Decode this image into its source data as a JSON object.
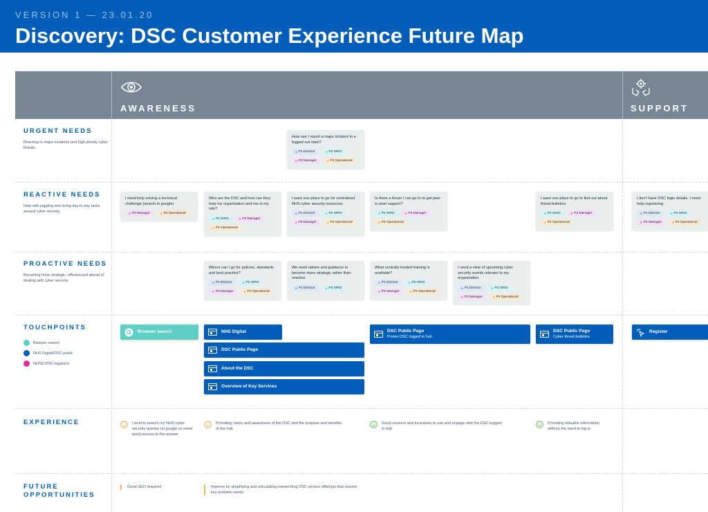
{
  "header": {
    "version": "VERSION 1 — 23.01.20",
    "title": "Discovery: DSC Customer Experience Future Map"
  },
  "phases": [
    {
      "label": "AWARENESS",
      "icon": "eye-icon"
    },
    {
      "label": "SUPPORT",
      "icon": "hands-gear-icon"
    }
  ],
  "rows": {
    "urgent": {
      "title": "URGENT NEEDS",
      "desc": "Reacting to major incidents and high priority cyber threats"
    },
    "reactive": {
      "title": "REACTIVE NEEDS",
      "desc": "Help with juggling and doing day-to-day tasks around cyber security"
    },
    "proactive": {
      "title": "PROACTIVE NEEDS",
      "desc": "Becoming more strategic, efficient and ahead in dealing with cyber security"
    },
    "touchpoints": {
      "title": "TOUCHPOINTS"
    },
    "experience": {
      "title": "EXPERIENCE"
    },
    "future": {
      "title": "FUTURE OPPORTUNITIES"
    }
  },
  "personas": {
    "p1": "P1 Director",
    "p2": "P2 SIRO",
    "p3": "P3 Manager",
    "p4": "P4 Operational"
  },
  "cards": {
    "urgent1": "How can I report a major incident in a logged out state?",
    "reactive1": "I need help solving a technical challenge (search in google)",
    "reactive2": "Who are the DSC and how can they help my organisation and me in my role?",
    "reactive3": "I want one place to go for centralised NHS cyber security resources",
    "reactive4": "Is there a forum I can go to to get peer to peer support?",
    "reactive5": "I want one place to go to find out about threat bulletins",
    "reactive6": "I don't have DSC login details. I need help registering",
    "proactive1": "Where can I go for policies, standards and best practice?",
    "proactive2": "We need advice and guidance to become more strategic rather than reactive",
    "proactive3": "What centrally funded training is available?",
    "proactive4": "I need a view of upcoming cyber security events relevant to my organisation"
  },
  "touchpoints": {
    "browser_search": "Browser search",
    "nhs_digital": "NHS Digital",
    "dsc_public_page": "DSC Public Page",
    "about_dsc": "About the DSC",
    "overview": "Overview of Key Services",
    "dsc_public_page_promo": "DSC Public Page",
    "promo_sub": "Promo DSC logged in hub",
    "dsc_public_page_cyber": "DSC Public Page",
    "cyber_sub": "Cyber threat bulletins",
    "register": "Register"
  },
  "legend": [
    {
      "label": "Browser search",
      "color": "#5ecfc4"
    },
    {
      "label": "NHS Digital/DSC public",
      "color": "#005eb8"
    },
    {
      "label": "NHSD DSC logged in",
      "color": "#e8288f"
    }
  ],
  "experience": {
    "e1": "I tend to search my NHS cyber security queries on google so need quick access to the answer",
    "e2": "Providing clarity and awareness of the DSC and the purpose and benefits of the hub",
    "e3": "Good reasons and incentives to use and engage with the DSC logged in hub",
    "e4": "Providing valuable information without the need to log in"
  },
  "future": {
    "f1": "Good SEO required",
    "f2": "Improve by simplifying and articulating overarching DSC service offerings that resolve key problem needs"
  },
  "colors": {
    "brand_blue": "#005eb8",
    "phase_grey": "#768692",
    "teal": "#5ecfc4",
    "pink": "#e8288f",
    "neutral_face": "#f0a24b",
    "happy_face": "#5cc24a"
  }
}
